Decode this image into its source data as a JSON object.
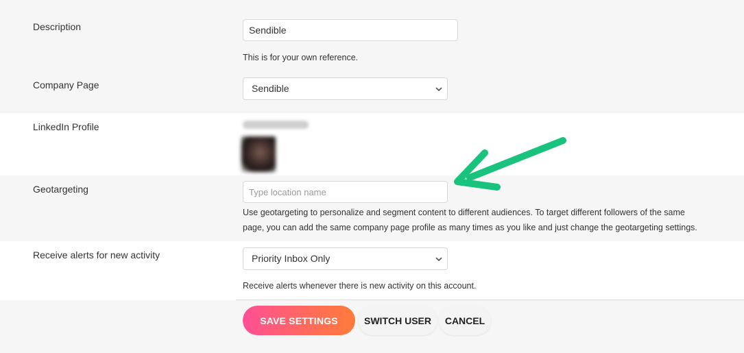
{
  "fields": {
    "description": {
      "label": "Description",
      "value": "Sendible",
      "help": "This is for your own reference."
    },
    "company_page": {
      "label": "Company Page",
      "selected": "Sendible"
    },
    "linkedin_profile": {
      "label": "LinkedIn Profile"
    },
    "geotargeting": {
      "label": "Geotargeting",
      "placeholder": "Type location name",
      "help_line1": "Use geotargeting to personalize and segment content to different audiences. To target different followers of the same",
      "help_line2": "page, you can add the same company page profile as many times as you like and just change the geotargeting settings."
    },
    "alerts": {
      "label": "Receive alerts for new activity",
      "selected": "Priority Inbox Only",
      "help": "Receive alerts whenever there is new activity on this account."
    }
  },
  "actions": {
    "save": "SAVE SETTINGS",
    "switch_user": "SWITCH USER",
    "cancel": "CANCEL"
  },
  "colors": {
    "annotation_arrow": "#19c37d",
    "save_gradient_start": "#ff4f95",
    "save_gradient_end": "#ff7b3a"
  },
  "icons": [
    "chevron-down-icon",
    "annotation-arrow-icon"
  ]
}
